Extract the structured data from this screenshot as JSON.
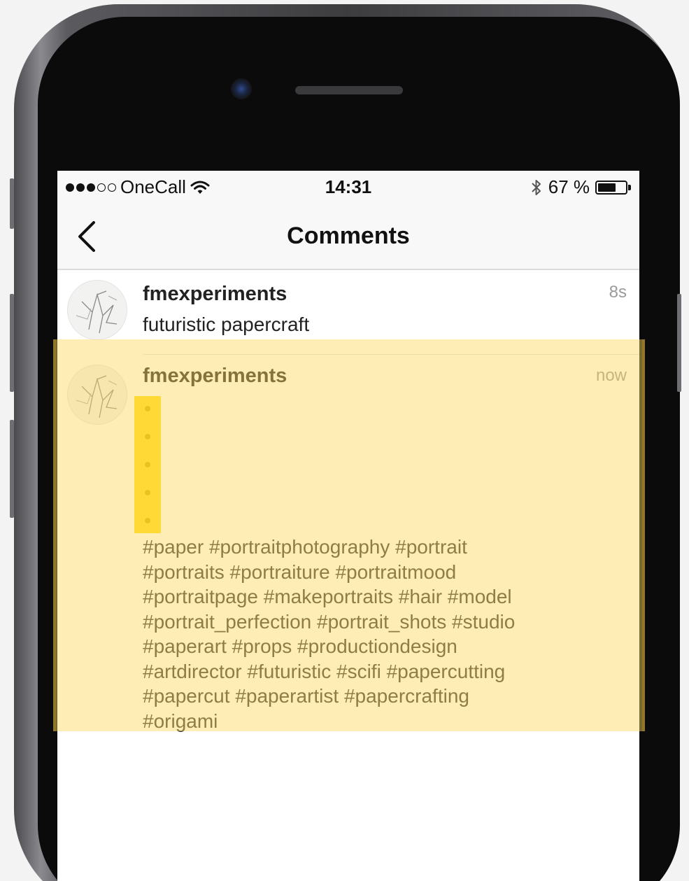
{
  "status_bar": {
    "carrier": "OneCall",
    "time": "14:31",
    "battery_percent": "67 %",
    "battery_level": 0.67,
    "signal_filled": 3,
    "signal_total": 5
  },
  "nav": {
    "title": "Comments"
  },
  "comments": [
    {
      "username": "fmexperiments",
      "time": "8s",
      "text": "futuristic papercraft"
    },
    {
      "username": "fmexperiments",
      "time": "now",
      "bullets": [
        "•",
        "•",
        "•",
        "•",
        "•"
      ],
      "hashtag_lines": [
        "#paper #portraitphotography #portrait",
        "#portraits #portraiture #portraitmood",
        "#portraitpage #makeportraits #hair #model",
        "#portrait_perfection #portrait_shots #studio",
        "#paperart #props #productiondesign",
        "#artdirector #futuristic #scifi #papercutting",
        "#papercut #paperartist #papercrafting",
        "#origami"
      ]
    }
  ],
  "colors": {
    "highlight": "#fdd75a",
    "bullet_highlight": "#ffd200"
  }
}
